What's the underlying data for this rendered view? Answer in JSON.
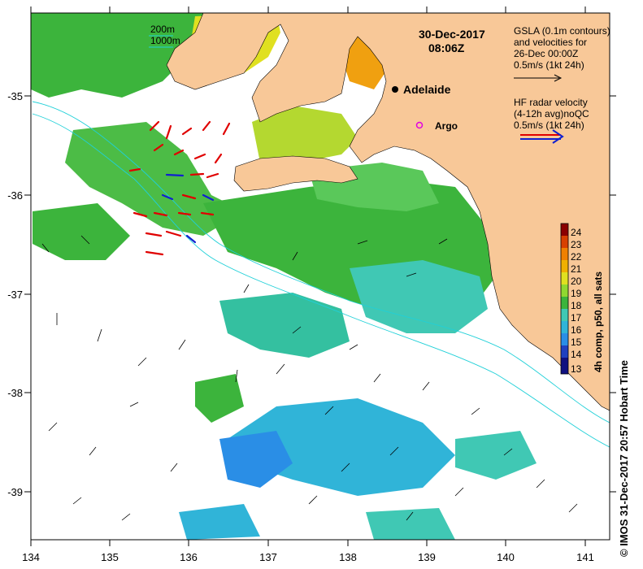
{
  "map": {
    "date": "30-Dec-2017",
    "time": "08:06Z",
    "x_ticks": [
      "134",
      "135",
      "136",
      "137",
      "138",
      "139",
      "140",
      "141"
    ],
    "y_ticks": [
      "-35",
      "-36",
      "-37",
      "-38",
      "-39"
    ],
    "bathymetry": {
      "contour_200": "200m",
      "contour_1000": "1000m"
    },
    "places": {
      "adelaide": "Adelaide",
      "argo": "Argo"
    },
    "gsla_legend": [
      "GSLA (0.1m contours)",
      "and velocities for",
      "26-Dec 00:00Z",
      "0.5m/s (1kt 24h)"
    ],
    "hf_legend": [
      "HF radar velocity",
      "(4-12h avg)noQC",
      "0.5m/s (1kt 24h)"
    ],
    "colorbar": {
      "title": "4h comp, p50, all sats",
      "ticks": [
        "24",
        "23",
        "22",
        "21",
        "20",
        "19",
        "18",
        "17",
        "16",
        "15",
        "14",
        "13"
      ]
    },
    "credit": "© IMOS 31-Dec-2017 20:57 Hobart Time"
  },
  "colors": {
    "land": "#f8c898",
    "cloud": "#ffffff",
    "sst_green": "#3cb43c",
    "sst_lightgreen": "#5ac85a",
    "sst_cyan": "#40c8b4",
    "sst_teal": "#30b4d8",
    "sst_blue": "#2a8ee6",
    "sst_yellow": "#e0e020",
    "sst_orange": "#f0a010",
    "isobath": "#20d0d8",
    "hf_red": "#e00000",
    "hf_blue": "#1020d0"
  }
}
